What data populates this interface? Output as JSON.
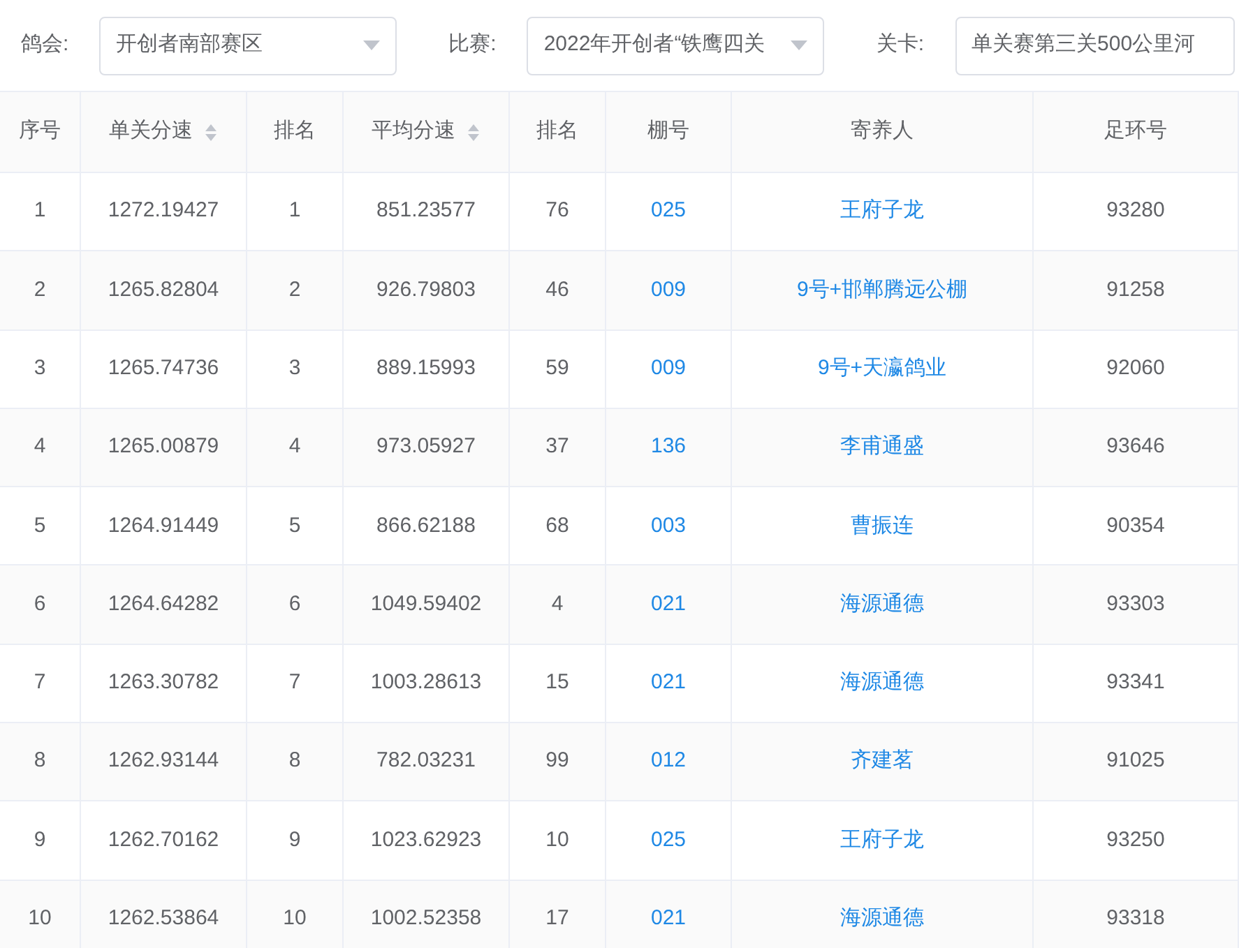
{
  "filters": [
    {
      "label": "鸽会:",
      "value": "开创者南部赛区",
      "dropdown": true
    },
    {
      "label": "比赛:",
      "value": "2022年开创者“铁鹰四关",
      "dropdown": true
    },
    {
      "label": "关卡:",
      "value": "单关赛第三关500公里河",
      "dropdown": false
    }
  ],
  "table": {
    "columns": [
      {
        "label": "序号",
        "sortable": false
      },
      {
        "label": "单关分速",
        "sortable": true
      },
      {
        "label": "排名",
        "sortable": false
      },
      {
        "label": "平均分速",
        "sortable": true
      },
      {
        "label": "排名",
        "sortable": false
      },
      {
        "label": "棚号",
        "sortable": false
      },
      {
        "label": "寄养人",
        "sortable": false
      },
      {
        "label": "足环号",
        "sortable": false
      }
    ],
    "rows": [
      [
        "1",
        "1272.19427",
        "1",
        "851.23577",
        "76",
        "025",
        "王府子龙",
        "93280"
      ],
      [
        "2",
        "1265.82804",
        "2",
        "926.79803",
        "46",
        "009",
        "9号+邯郸腾远公棚",
        "91258"
      ],
      [
        "3",
        "1265.74736",
        "3",
        "889.15993",
        "59",
        "009",
        "9号+天瀛鸽业",
        "92060"
      ],
      [
        "4",
        "1265.00879",
        "4",
        "973.05927",
        "37",
        "136",
        "李甫通盛",
        "93646"
      ],
      [
        "5",
        "1264.91449",
        "5",
        "866.62188",
        "68",
        "003",
        "曹振连",
        "90354"
      ],
      [
        "6",
        "1264.64282",
        "6",
        "1049.59402",
        "4",
        "021",
        "海源通德",
        "93303"
      ],
      [
        "7",
        "1263.30782",
        "7",
        "1003.28613",
        "15",
        "021",
        "海源通德",
        "93341"
      ],
      [
        "8",
        "1262.93144",
        "8",
        "782.03231",
        "99",
        "012",
        "齐建茗",
        "91025"
      ],
      [
        "9",
        "1262.70162",
        "9",
        "1023.62923",
        "10",
        "025",
        "王府子龙",
        "93250"
      ],
      [
        "10",
        "1262.53864",
        "10",
        "1002.52358",
        "17",
        "021",
        "海源通德",
        "93318"
      ]
    ]
  }
}
